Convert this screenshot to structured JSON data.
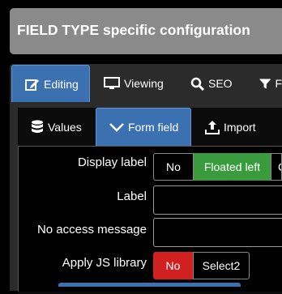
{
  "header": {
    "title": "FIELD TYPE specific configuration"
  },
  "main_tabs": [
    {
      "label": "Editing",
      "icon": "edit-icon"
    },
    {
      "label": "Viewing",
      "icon": "monitor-icon"
    },
    {
      "label": "SEO",
      "icon": "search-icon"
    },
    {
      "label": "F",
      "icon": "filter-icon"
    }
  ],
  "sub_tabs": [
    {
      "label": "Values",
      "icon": "database-icon"
    },
    {
      "label": "Form field",
      "icon": "chevron-down-icon"
    },
    {
      "label": "Import",
      "icon": "upload-icon"
    }
  ],
  "form": {
    "display_label": {
      "label": "Display label",
      "options": [
        "No",
        "Floated left",
        "C"
      ],
      "selected": "Floated left"
    },
    "label": {
      "label": "Label",
      "value": ""
    },
    "no_access_message": {
      "label": "No access message",
      "value": ""
    },
    "apply_js_library": {
      "label": "Apply JS library",
      "options": [
        "No",
        "Select2"
      ],
      "selected": "No"
    }
  },
  "colors": {
    "accent_blue": "#3b70b1",
    "selected_green": "#3a9b3d",
    "selected_red": "#d02020",
    "header_gray": "#8a8a8a"
  }
}
